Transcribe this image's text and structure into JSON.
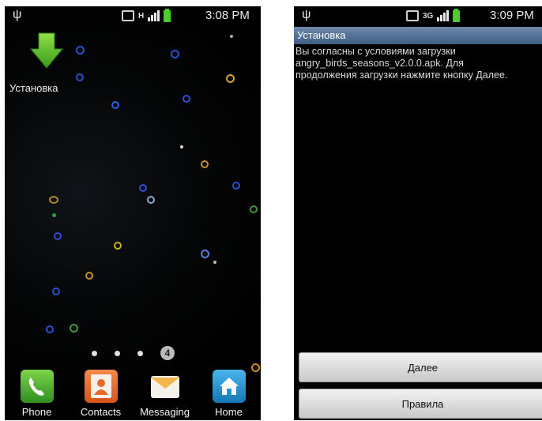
{
  "left_screen": {
    "status": {
      "usb_icon": "usb-icon",
      "network": "H",
      "time": "3:08 PM"
    },
    "shortcut": {
      "label": "Установка",
      "icon": "download-arrow-icon",
      "color": "#5dc227"
    },
    "pager": {
      "current_page": "4",
      "dot_count": 3
    },
    "dock": [
      {
        "label": "Phone",
        "icon": "phone-icon",
        "color": "#3fa52a"
      },
      {
        "label": "Contacts",
        "icon": "contacts-icon",
        "color": "#e9692a"
      },
      {
        "label": "Messaging",
        "icon": "messaging-icon",
        "color": "#f3b64a"
      },
      {
        "label": "Home",
        "icon": "home-icon",
        "color": "#1f95d4"
      }
    ]
  },
  "right_screen": {
    "status": {
      "usb_icon": "usb-icon",
      "network": "3G",
      "time": "3:09 PM"
    },
    "dialog_title": "Установка",
    "message": "Вы согласны с условиями  загрузки\nangry_birds_seasons_v2.0.0.apk. Для\nпродолжения загрузки нажмите кнопку Далее.",
    "buttons": {
      "next": "Далее",
      "rules": "Правила"
    }
  }
}
